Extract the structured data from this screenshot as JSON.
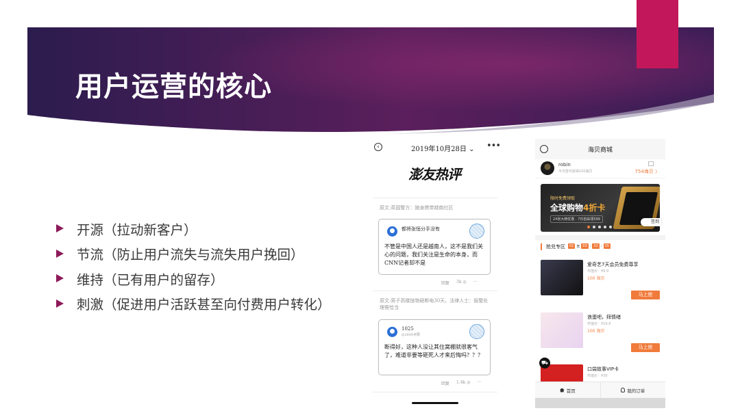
{
  "slide": {
    "title": "用户运营的核心",
    "accent_color": "#c2185b",
    "banner_colors": [
      "#2c1c4e",
      "#5a1f5c",
      "#7d2264"
    ],
    "bullets": [
      "开源（拉动新客户）",
      "节流（防止用户流失与流失用户挽回）",
      "维持（已有用户的留存）",
      "刺激（促进用户活跃甚至向付费用户转化）"
    ]
  },
  "phone1": {
    "back_icon": "back-circle-icon",
    "date": "2019年10月28日 ⌄",
    "more": "•••",
    "logo_text": "澎友热评",
    "source1": "原文:英国警方：随身携带越南社区",
    "card1": {
      "user": "都将张恒分手没有",
      "text": "不管是中国人还是越南人，这不是我们关心的问题，我们关注是生命的本身，而CNN记者却不是",
      "reply": "回复",
      "likes": "3k ◎",
      "more": "···"
    },
    "source2": "原文:男子高楼抛物砸断电30天、法律人士：报警处理需恰当",
    "card2": {
      "user": "1025",
      "sub": "◎2689点赞",
      "text": "断得好，这种人没让其住窝棚就很客气了，难道非要等砸死人才来后悔吗？？？",
      "reply": "回复",
      "likes": "1.4k ◎",
      "more": "···"
    }
  },
  "phone2": {
    "title": "海贝商城",
    "user_name": "robin",
    "user_tip": "今日签可获得100海贝",
    "coins": "754海贝 〉",
    "banner": {
      "line1": "限时免费领取",
      "line2_a": "全球购物",
      "line2_b": "4折卡",
      "line3": "24张大牌优惠 · 7日自由领599"
    },
    "sign_label": "签到",
    "section_title": "抢兑专区",
    "timer": [
      "02",
      "天",
      "03",
      ":",
      "22",
      ":",
      "35"
    ],
    "items": [
      {
        "name": "爱奇艺7天会员免费尊享",
        "old_price": "市值价：¥9.9",
        "price": "100 海贝",
        "button": "马上抢",
        "thumb_color": "#2a2a3a"
      },
      {
        "name": "浪蛋吧，拜情绪",
        "old_price": "市值价：¥19.9",
        "price": "100 海贝",
        "button": "马上抢",
        "thumb_color": "#f3dfe6"
      },
      {
        "name": "口袋故事VIP卡",
        "old_price": "市值价：¥30",
        "price": "",
        "button": "",
        "thumb_color": "#d32020"
      }
    ],
    "tabs": [
      {
        "label": "首页",
        "icon": "home-icon"
      },
      {
        "label": "我的订单",
        "icon": "user-icon"
      }
    ],
    "accent": "#f07b3b"
  }
}
